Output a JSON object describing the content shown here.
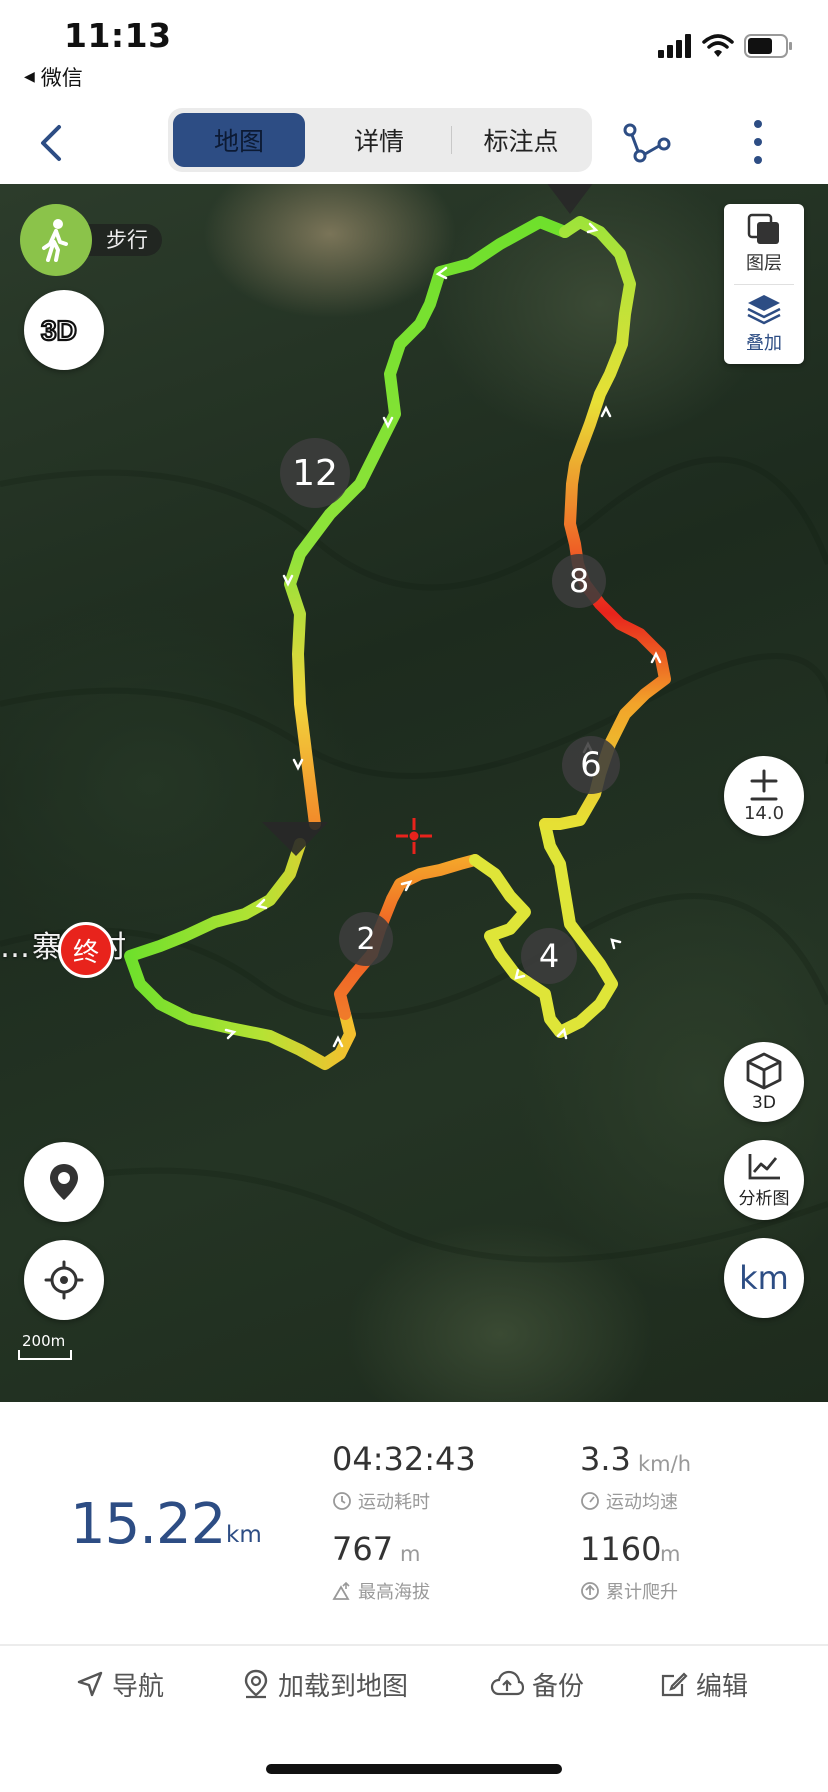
{
  "status_bar": {
    "time": "11:13",
    "back_app": "微信"
  },
  "nav": {
    "tabs": [
      {
        "label": "地图",
        "active": true
      },
      {
        "label": "详情",
        "active": false
      },
      {
        "label": "标注点",
        "active": false
      }
    ]
  },
  "map": {
    "mode_label": "步行",
    "layers_label": "图层",
    "overlay_label": "叠加",
    "zoom_level": "14.0",
    "btn_3d_label": "3D",
    "analysis_label": "分析图",
    "unit_label": "km",
    "end_marker": "终",
    "scale_label": "200m",
    "village_label": "…寨沟村",
    "km_markers": [
      "2",
      "4",
      "6",
      "8",
      "12"
    ],
    "colors": {
      "accent": "#2d4d84",
      "route_fast": "#6fe02c",
      "route_slow": "#e8231c",
      "end": "#e8231c"
    }
  },
  "stats": {
    "distance": "15.22",
    "distance_unit": "km",
    "duration": "04:32:43",
    "duration_label": "运动耗时",
    "avg_speed": "3.3",
    "avg_speed_unit": "km/h",
    "avg_speed_label": "运动均速",
    "max_altitude": "767",
    "max_altitude_unit": "m",
    "max_altitude_label": "最高海拔",
    "total_ascent": "1160",
    "total_ascent_unit": "m",
    "total_ascent_label": "累计爬升"
  },
  "actions": {
    "navigate": "导航",
    "load_to_map": "加载到地图",
    "backup": "备份",
    "edit": "编辑"
  }
}
